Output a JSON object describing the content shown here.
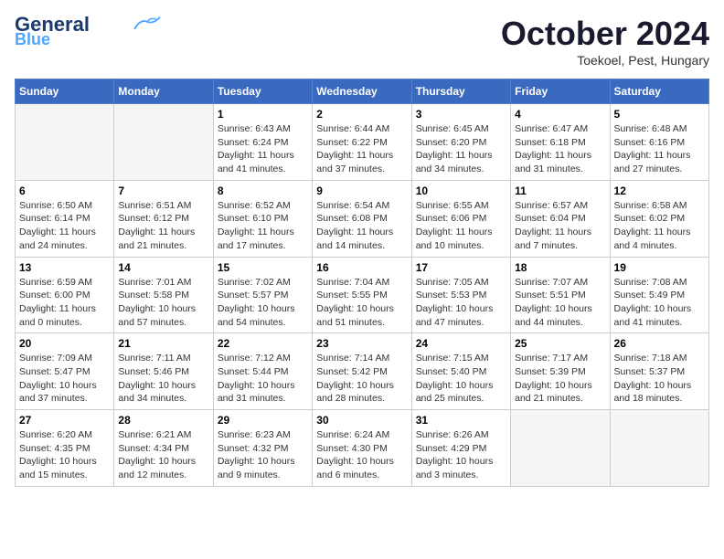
{
  "header": {
    "logo_line1": "General",
    "logo_line2": "Blue",
    "month_title": "October 2024",
    "subtitle": "Toekoel, Pest, Hungary"
  },
  "weekdays": [
    "Sunday",
    "Monday",
    "Tuesday",
    "Wednesday",
    "Thursday",
    "Friday",
    "Saturday"
  ],
  "weeks": [
    [
      {
        "day": "",
        "info": ""
      },
      {
        "day": "",
        "info": ""
      },
      {
        "day": "1",
        "info": "Sunrise: 6:43 AM\nSunset: 6:24 PM\nDaylight: 11 hours and 41 minutes."
      },
      {
        "day": "2",
        "info": "Sunrise: 6:44 AM\nSunset: 6:22 PM\nDaylight: 11 hours and 37 minutes."
      },
      {
        "day": "3",
        "info": "Sunrise: 6:45 AM\nSunset: 6:20 PM\nDaylight: 11 hours and 34 minutes."
      },
      {
        "day": "4",
        "info": "Sunrise: 6:47 AM\nSunset: 6:18 PM\nDaylight: 11 hours and 31 minutes."
      },
      {
        "day": "5",
        "info": "Sunrise: 6:48 AM\nSunset: 6:16 PM\nDaylight: 11 hours and 27 minutes."
      }
    ],
    [
      {
        "day": "6",
        "info": "Sunrise: 6:50 AM\nSunset: 6:14 PM\nDaylight: 11 hours and 24 minutes."
      },
      {
        "day": "7",
        "info": "Sunrise: 6:51 AM\nSunset: 6:12 PM\nDaylight: 11 hours and 21 minutes."
      },
      {
        "day": "8",
        "info": "Sunrise: 6:52 AM\nSunset: 6:10 PM\nDaylight: 11 hours and 17 minutes."
      },
      {
        "day": "9",
        "info": "Sunrise: 6:54 AM\nSunset: 6:08 PM\nDaylight: 11 hours and 14 minutes."
      },
      {
        "day": "10",
        "info": "Sunrise: 6:55 AM\nSunset: 6:06 PM\nDaylight: 11 hours and 10 minutes."
      },
      {
        "day": "11",
        "info": "Sunrise: 6:57 AM\nSunset: 6:04 PM\nDaylight: 11 hours and 7 minutes."
      },
      {
        "day": "12",
        "info": "Sunrise: 6:58 AM\nSunset: 6:02 PM\nDaylight: 11 hours and 4 minutes."
      }
    ],
    [
      {
        "day": "13",
        "info": "Sunrise: 6:59 AM\nSunset: 6:00 PM\nDaylight: 11 hours and 0 minutes."
      },
      {
        "day": "14",
        "info": "Sunrise: 7:01 AM\nSunset: 5:58 PM\nDaylight: 10 hours and 57 minutes."
      },
      {
        "day": "15",
        "info": "Sunrise: 7:02 AM\nSunset: 5:57 PM\nDaylight: 10 hours and 54 minutes."
      },
      {
        "day": "16",
        "info": "Sunrise: 7:04 AM\nSunset: 5:55 PM\nDaylight: 10 hours and 51 minutes."
      },
      {
        "day": "17",
        "info": "Sunrise: 7:05 AM\nSunset: 5:53 PM\nDaylight: 10 hours and 47 minutes."
      },
      {
        "day": "18",
        "info": "Sunrise: 7:07 AM\nSunset: 5:51 PM\nDaylight: 10 hours and 44 minutes."
      },
      {
        "day": "19",
        "info": "Sunrise: 7:08 AM\nSunset: 5:49 PM\nDaylight: 10 hours and 41 minutes."
      }
    ],
    [
      {
        "day": "20",
        "info": "Sunrise: 7:09 AM\nSunset: 5:47 PM\nDaylight: 10 hours and 37 minutes."
      },
      {
        "day": "21",
        "info": "Sunrise: 7:11 AM\nSunset: 5:46 PM\nDaylight: 10 hours and 34 minutes."
      },
      {
        "day": "22",
        "info": "Sunrise: 7:12 AM\nSunset: 5:44 PM\nDaylight: 10 hours and 31 minutes."
      },
      {
        "day": "23",
        "info": "Sunrise: 7:14 AM\nSunset: 5:42 PM\nDaylight: 10 hours and 28 minutes."
      },
      {
        "day": "24",
        "info": "Sunrise: 7:15 AM\nSunset: 5:40 PM\nDaylight: 10 hours and 25 minutes."
      },
      {
        "day": "25",
        "info": "Sunrise: 7:17 AM\nSunset: 5:39 PM\nDaylight: 10 hours and 21 minutes."
      },
      {
        "day": "26",
        "info": "Sunrise: 7:18 AM\nSunset: 5:37 PM\nDaylight: 10 hours and 18 minutes."
      }
    ],
    [
      {
        "day": "27",
        "info": "Sunrise: 6:20 AM\nSunset: 4:35 PM\nDaylight: 10 hours and 15 minutes."
      },
      {
        "day": "28",
        "info": "Sunrise: 6:21 AM\nSunset: 4:34 PM\nDaylight: 10 hours and 12 minutes."
      },
      {
        "day": "29",
        "info": "Sunrise: 6:23 AM\nSunset: 4:32 PM\nDaylight: 10 hours and 9 minutes."
      },
      {
        "day": "30",
        "info": "Sunrise: 6:24 AM\nSunset: 4:30 PM\nDaylight: 10 hours and 6 minutes."
      },
      {
        "day": "31",
        "info": "Sunrise: 6:26 AM\nSunset: 4:29 PM\nDaylight: 10 hours and 3 minutes."
      },
      {
        "day": "",
        "info": ""
      },
      {
        "day": "",
        "info": ""
      }
    ]
  ]
}
